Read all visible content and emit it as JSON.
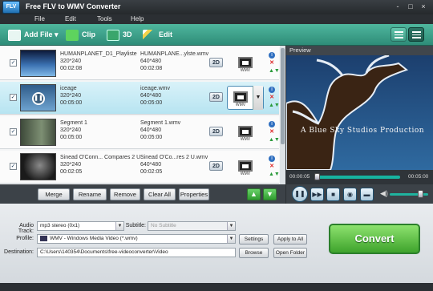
{
  "window": {
    "title": "Free FLV to WMV Converter",
    "icon_text": "FLV",
    "controls": [
      "-",
      "□",
      "×"
    ]
  },
  "menu": [
    "File",
    "Edit",
    "Tools",
    "Help"
  ],
  "toolbar": {
    "add_file": "Add File",
    "clip": "Clip",
    "three_d": "3D",
    "edit": "Edit",
    "colors": {
      "bar": "#3ea28a",
      "clip_icon": "#5ed35e",
      "3d_icon": "#3aa66c"
    }
  },
  "files": [
    {
      "checked": true,
      "source_name": "HUMANPLANET_D1_Playliste",
      "source_res": "320*240",
      "source_dur": "00:02:08",
      "out_name": "HUMANPLANE...ylste.wmv",
      "out_res": "640*480",
      "out_dur": "00:02:08",
      "mode": "2D",
      "format": "WMV"
    },
    {
      "checked": true,
      "source_name": "iceage",
      "source_res": "320*240",
      "source_dur": "00:05:00",
      "out_name": "iceage.wmv",
      "out_res": "640*480",
      "out_dur": "00:05:00",
      "mode": "2D",
      "format": "WMV"
    },
    {
      "checked": true,
      "source_name": "Segment 1",
      "source_res": "320*240",
      "source_dur": "00:05:00",
      "out_name": "Segment 1.wmv",
      "out_res": "640*480",
      "out_dur": "00:05:00",
      "mode": "2D",
      "format": "WMV"
    },
    {
      "checked": true,
      "source_name": "Sinead O'Conn... Compares 2 U",
      "source_res": "320*240",
      "source_dur": "00:02:05",
      "out_name": "Sinead O'Co...res 2 U.wmv",
      "out_res": "640*480",
      "out_dur": "00:02:05",
      "mode": "2D",
      "format": "WMV"
    }
  ],
  "actions": {
    "merge": "Merge",
    "rename": "Rename",
    "remove": "Remove",
    "clear_all": "Clear All",
    "properties": "Properties",
    "up": "▲",
    "down": "▼"
  },
  "preview": {
    "header": "Preview",
    "caption": "A Blue Sky Studios Production",
    "time_current": "00:00:05",
    "time_total": "00:05:00",
    "progress": 0.02,
    "volume": 0.8
  },
  "settings": {
    "audio_track_label": "Audio Track:",
    "audio_track_value": "mp3 stereo (0x1)",
    "subtitle_label": "Subtitle:",
    "subtitle_value": "No Subtitle",
    "profile_label": "Profile:",
    "profile_value": "WMV - Windows Media Video (*.wmv)",
    "settings_btn": "Settings",
    "apply_all_btn": "Apply to All",
    "destination_label": "Destination:",
    "destination_value": "C:\\Users\\140354\\Documents\\free-videoconverter\\Video",
    "browse_btn": "Browse",
    "open_folder_btn": "Open Folder",
    "convert_btn": "Convert"
  }
}
